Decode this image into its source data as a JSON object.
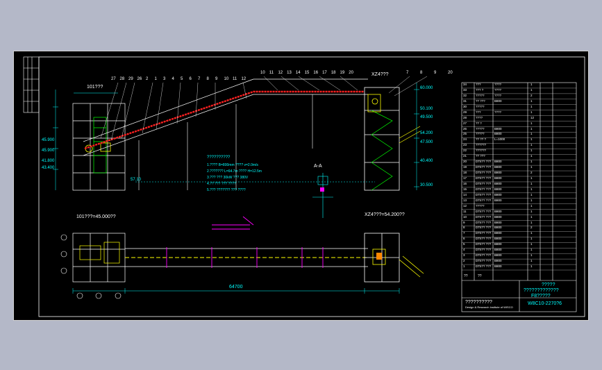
{
  "drawing": {
    "elevation_view_label": "101???",
    "plan_view_label": "101???=45.000??",
    "section_label_a": "A-A",
    "tower_label_top": "XZ4???",
    "tower_label_plan": "XZ4???=54.200??",
    "callout_numbers_left": [
      "27",
      "28",
      "29",
      "26",
      "2",
      "1",
      "3",
      "4",
      "5",
      "6",
      "7",
      "8",
      "9",
      "10",
      "11",
      "12"
    ],
    "callout_numbers_top": [
      "10",
      "11",
      "12",
      "13",
      "14",
      "15",
      "16",
      "17",
      "18",
      "19",
      "20"
    ],
    "callout_numbers_right": [
      "7",
      "8",
      "9",
      "20"
    ],
    "elevations": [
      "45.900",
      "41.800",
      "57.10",
      "50.100",
      "49.500",
      "60.000",
      "54.200",
      "47.500",
      "45.900",
      "43.400",
      "40.400",
      "30.500"
    ],
    "dimension_total": "64700",
    "notes_title": "??????????",
    "notes_lines": [
      "1.???? B=800mm  ???? v=2.0m/s",
      "2.??????? L=64.7m  ???? H=12.5m",
      "3.??? ??? 30kW  ??? 380V",
      "4.?? ??? ??? ????",
      "5.??? ??????? ??? ????"
    ]
  },
  "title_block": {
    "items": [
      {
        "no": "34",
        "name": "???",
        "spec": "????",
        "qty": "1",
        "note": ""
      },
      {
        "no": "33",
        "name": "??? ?",
        "spec": "????",
        "qty": "1",
        "note": ""
      },
      {
        "no": "32",
        "name": "?????",
        "spec": "????",
        "qty": "2",
        "note": ""
      },
      {
        "no": "31",
        "name": "?? ???",
        "spec": "B800",
        "qty": "1",
        "note": ""
      },
      {
        "no": "30",
        "name": "?????",
        "spec": "",
        "qty": "1",
        "note": ""
      },
      {
        "no": "29",
        "name": "???",
        "spec": "????",
        "qty": "1",
        "note": ""
      },
      {
        "no": "28",
        "name": "????",
        "spec": "",
        "qty": "12",
        "note": ""
      },
      {
        "no": "27",
        "name": "?? ?",
        "spec": "",
        "qty": "1",
        "note": ""
      },
      {
        "no": "26",
        "name": "?????",
        "spec": "B800",
        "qty": "1",
        "note": ""
      },
      {
        "no": "25",
        "name": "?????",
        "spec": "B800",
        "qty": "1",
        "note": ""
      },
      {
        "no": "24",
        "name": "?? ?? ?",
        "spec": "L=1000",
        "qty": "1",
        "note": ""
      },
      {
        "no": "23",
        "name": "??????",
        "spec": "",
        "qty": "1",
        "note": ""
      },
      {
        "no": "22",
        "name": "??????",
        "spec": "",
        "qty": "1",
        "note": ""
      },
      {
        "no": "21",
        "name": "?? ???",
        "spec": "",
        "qty": "1",
        "note": ""
      },
      {
        "no": "20",
        "name": "DTII?? ???",
        "spec": "B800",
        "qty": "1",
        "note": ""
      },
      {
        "no": "19",
        "name": "DTII?? ???",
        "spec": "B800",
        "qty": "1",
        "note": ""
      },
      {
        "no": "18",
        "name": "DTII?? ???",
        "spec": "B800",
        "qty": "2",
        "note": ""
      },
      {
        "no": "17",
        "name": "DTII?? ???",
        "spec": "B800",
        "qty": "1",
        "note": ""
      },
      {
        "no": "16",
        "name": "DTII?? ???",
        "spec": "B800",
        "qty": "1",
        "note": ""
      },
      {
        "no": "15",
        "name": "DTII?? ???",
        "spec": "B800",
        "qty": "1",
        "note": ""
      },
      {
        "no": "14",
        "name": "DTII?? ???",
        "spec": "B800",
        "qty": "1",
        "note": ""
      },
      {
        "no": "13",
        "name": "DTII?? ???",
        "spec": "B800",
        "qty": "1",
        "note": ""
      },
      {
        "no": "12",
        "name": "?????",
        "spec": "",
        "qty": "1",
        "note": ""
      },
      {
        "no": "11",
        "name": "DTII?? ???",
        "spec": "B800",
        "qty": "1",
        "note": ""
      },
      {
        "no": "10",
        "name": "DTII?? ???",
        "spec": "B800",
        "qty": "1",
        "note": ""
      },
      {
        "no": "9",
        "name": "DTII?? ???",
        "spec": "B800",
        "qty": "1",
        "note": ""
      },
      {
        "no": "8",
        "name": "DTII?? ???",
        "spec": "B800",
        "qty": "2",
        "note": ""
      },
      {
        "no": "7",
        "name": "DTII?? ???",
        "spec": "B800",
        "qty": "1",
        "note": ""
      },
      {
        "no": "6",
        "name": "DTII?? ???",
        "spec": "B800",
        "qty": "1",
        "note": ""
      },
      {
        "no": "5",
        "name": "DTII?? ???",
        "spec": "B800",
        "qty": "1",
        "note": ""
      },
      {
        "no": "4",
        "name": "DTII?? ???",
        "spec": "B800",
        "qty": "1",
        "note": ""
      },
      {
        "no": "3",
        "name": "DTII?? ???",
        "spec": "B800",
        "qty": "1",
        "note": ""
      },
      {
        "no": "2",
        "name": "DTII?? ???",
        "spec": "B800",
        "qty": "1",
        "note": ""
      },
      {
        "no": "1",
        "name": "DTII?? ???",
        "spec": "B800",
        "qty": "1",
        "note": ""
      }
    ],
    "header_no": "??",
    "header_name": "??",
    "project_line1": "?????",
    "project_line2": "?????????????",
    "project_line3": "F8?????",
    "institute_name": "??????????",
    "institute_name_en": "Design & Research Institute of WISCO",
    "drawing_number": "W8C10-2270?6"
  },
  "colors": {
    "background": "#b4b8c8",
    "sheet": "#000000",
    "structure": "#ffffff",
    "dimension": "#00ffff",
    "conveyor": "#ff2020",
    "equipment": "#ffff00",
    "highlight": "#ff00ff"
  }
}
